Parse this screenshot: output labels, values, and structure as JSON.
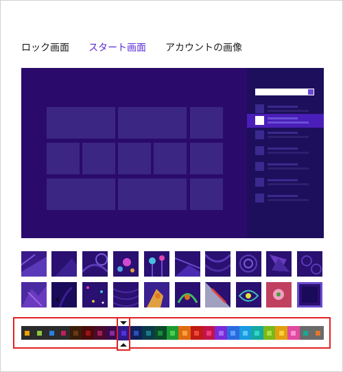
{
  "tabs": [
    {
      "label": "ロック画面",
      "active": false
    },
    {
      "label": "スタート画面",
      "active": true
    },
    {
      "label": "アカウントの画像",
      "active": false
    }
  ],
  "colors": {
    "accent": "#5b2bd6",
    "preview_bg": "#2a0b6b",
    "highlight": "#e02020"
  },
  "palette": [
    {
      "bg": "#2b2b2b",
      "dot": "#f0a000"
    },
    {
      "bg": "#2b2b2b",
      "dot": "#8ec63f"
    },
    {
      "bg": "#2b2b2b",
      "dot": "#2d7ee0"
    },
    {
      "bg": "#2b2b2b",
      "dot": "#c01f5c"
    },
    {
      "bg": "#3a1d08",
      "dot": "#6a3818"
    },
    {
      "bg": "#4a0a0a",
      "dot": "#9a1414"
    },
    {
      "bg": "#4a0a2a",
      "dot": "#a01e5a"
    },
    {
      "bg": "#3a0a4a",
      "dot": "#8a2aa0"
    },
    {
      "bg": "#2e1a8a",
      "dot": "#5630d8"
    },
    {
      "bg": "#10205a",
      "dot": "#2a50b8"
    },
    {
      "bg": "#0a3a4a",
      "dot": "#1a7a8a"
    },
    {
      "bg": "#0a4a2a",
      "dot": "#1a8a3a"
    },
    {
      "bg": "#1a9a30",
      "dot": "#4ccf50"
    },
    {
      "bg": "#e06a10",
      "dot": "#f8a040"
    },
    {
      "bg": "#c01a14",
      "dot": "#f04a3a"
    },
    {
      "bg": "#c0144a",
      "dot": "#f03a7a"
    },
    {
      "bg": "#7a2ad8",
      "dot": "#a46cf0"
    },
    {
      "bg": "#2a6ae0",
      "dot": "#5aa0f8"
    },
    {
      "bg": "#1a9ae0",
      "dot": "#5ac8f8"
    },
    {
      "bg": "#14a8a0",
      "dot": "#30d8c8"
    },
    {
      "bg": "#7ab81a",
      "dot": "#a8e040"
    },
    {
      "bg": "#e0a010",
      "dot": "#f8d040"
    },
    {
      "bg": "#e04aa0",
      "dot": "#f890d0"
    },
    {
      "bg": "#6a6a6a",
      "dot": "#1aa890"
    },
    {
      "bg": "#6a6a6a",
      "dot": "#e07a2a"
    }
  ],
  "selected_swatch_index": 8
}
